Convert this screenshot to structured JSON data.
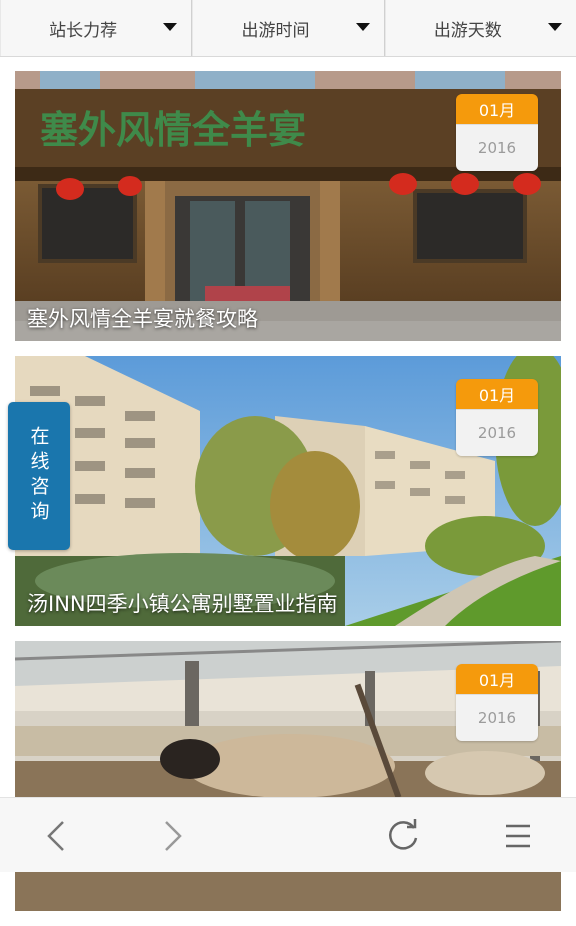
{
  "filters": [
    {
      "label": "站长力荐"
    },
    {
      "label": "出游时间"
    },
    {
      "label": "出游天数"
    }
  ],
  "articles": [
    {
      "title": "塞外风情全羊宴就餐攻略",
      "month": "01月",
      "year": "2016",
      "sign_text": "塞外风情全羊宴"
    },
    {
      "title": "汤INN四季小镇公寓别墅置业指南",
      "month": "01月",
      "year": "2016"
    },
    {
      "title": "",
      "month": "01月",
      "year": "2016"
    }
  ],
  "consult_label": "在线咨询",
  "toolbar": {
    "icons": [
      "back-icon",
      "forward-icon",
      "refresh-icon",
      "menu-icon"
    ]
  },
  "colors": {
    "badge_month": "#f59a0c",
    "consult_bg": "#1a76ad"
  }
}
